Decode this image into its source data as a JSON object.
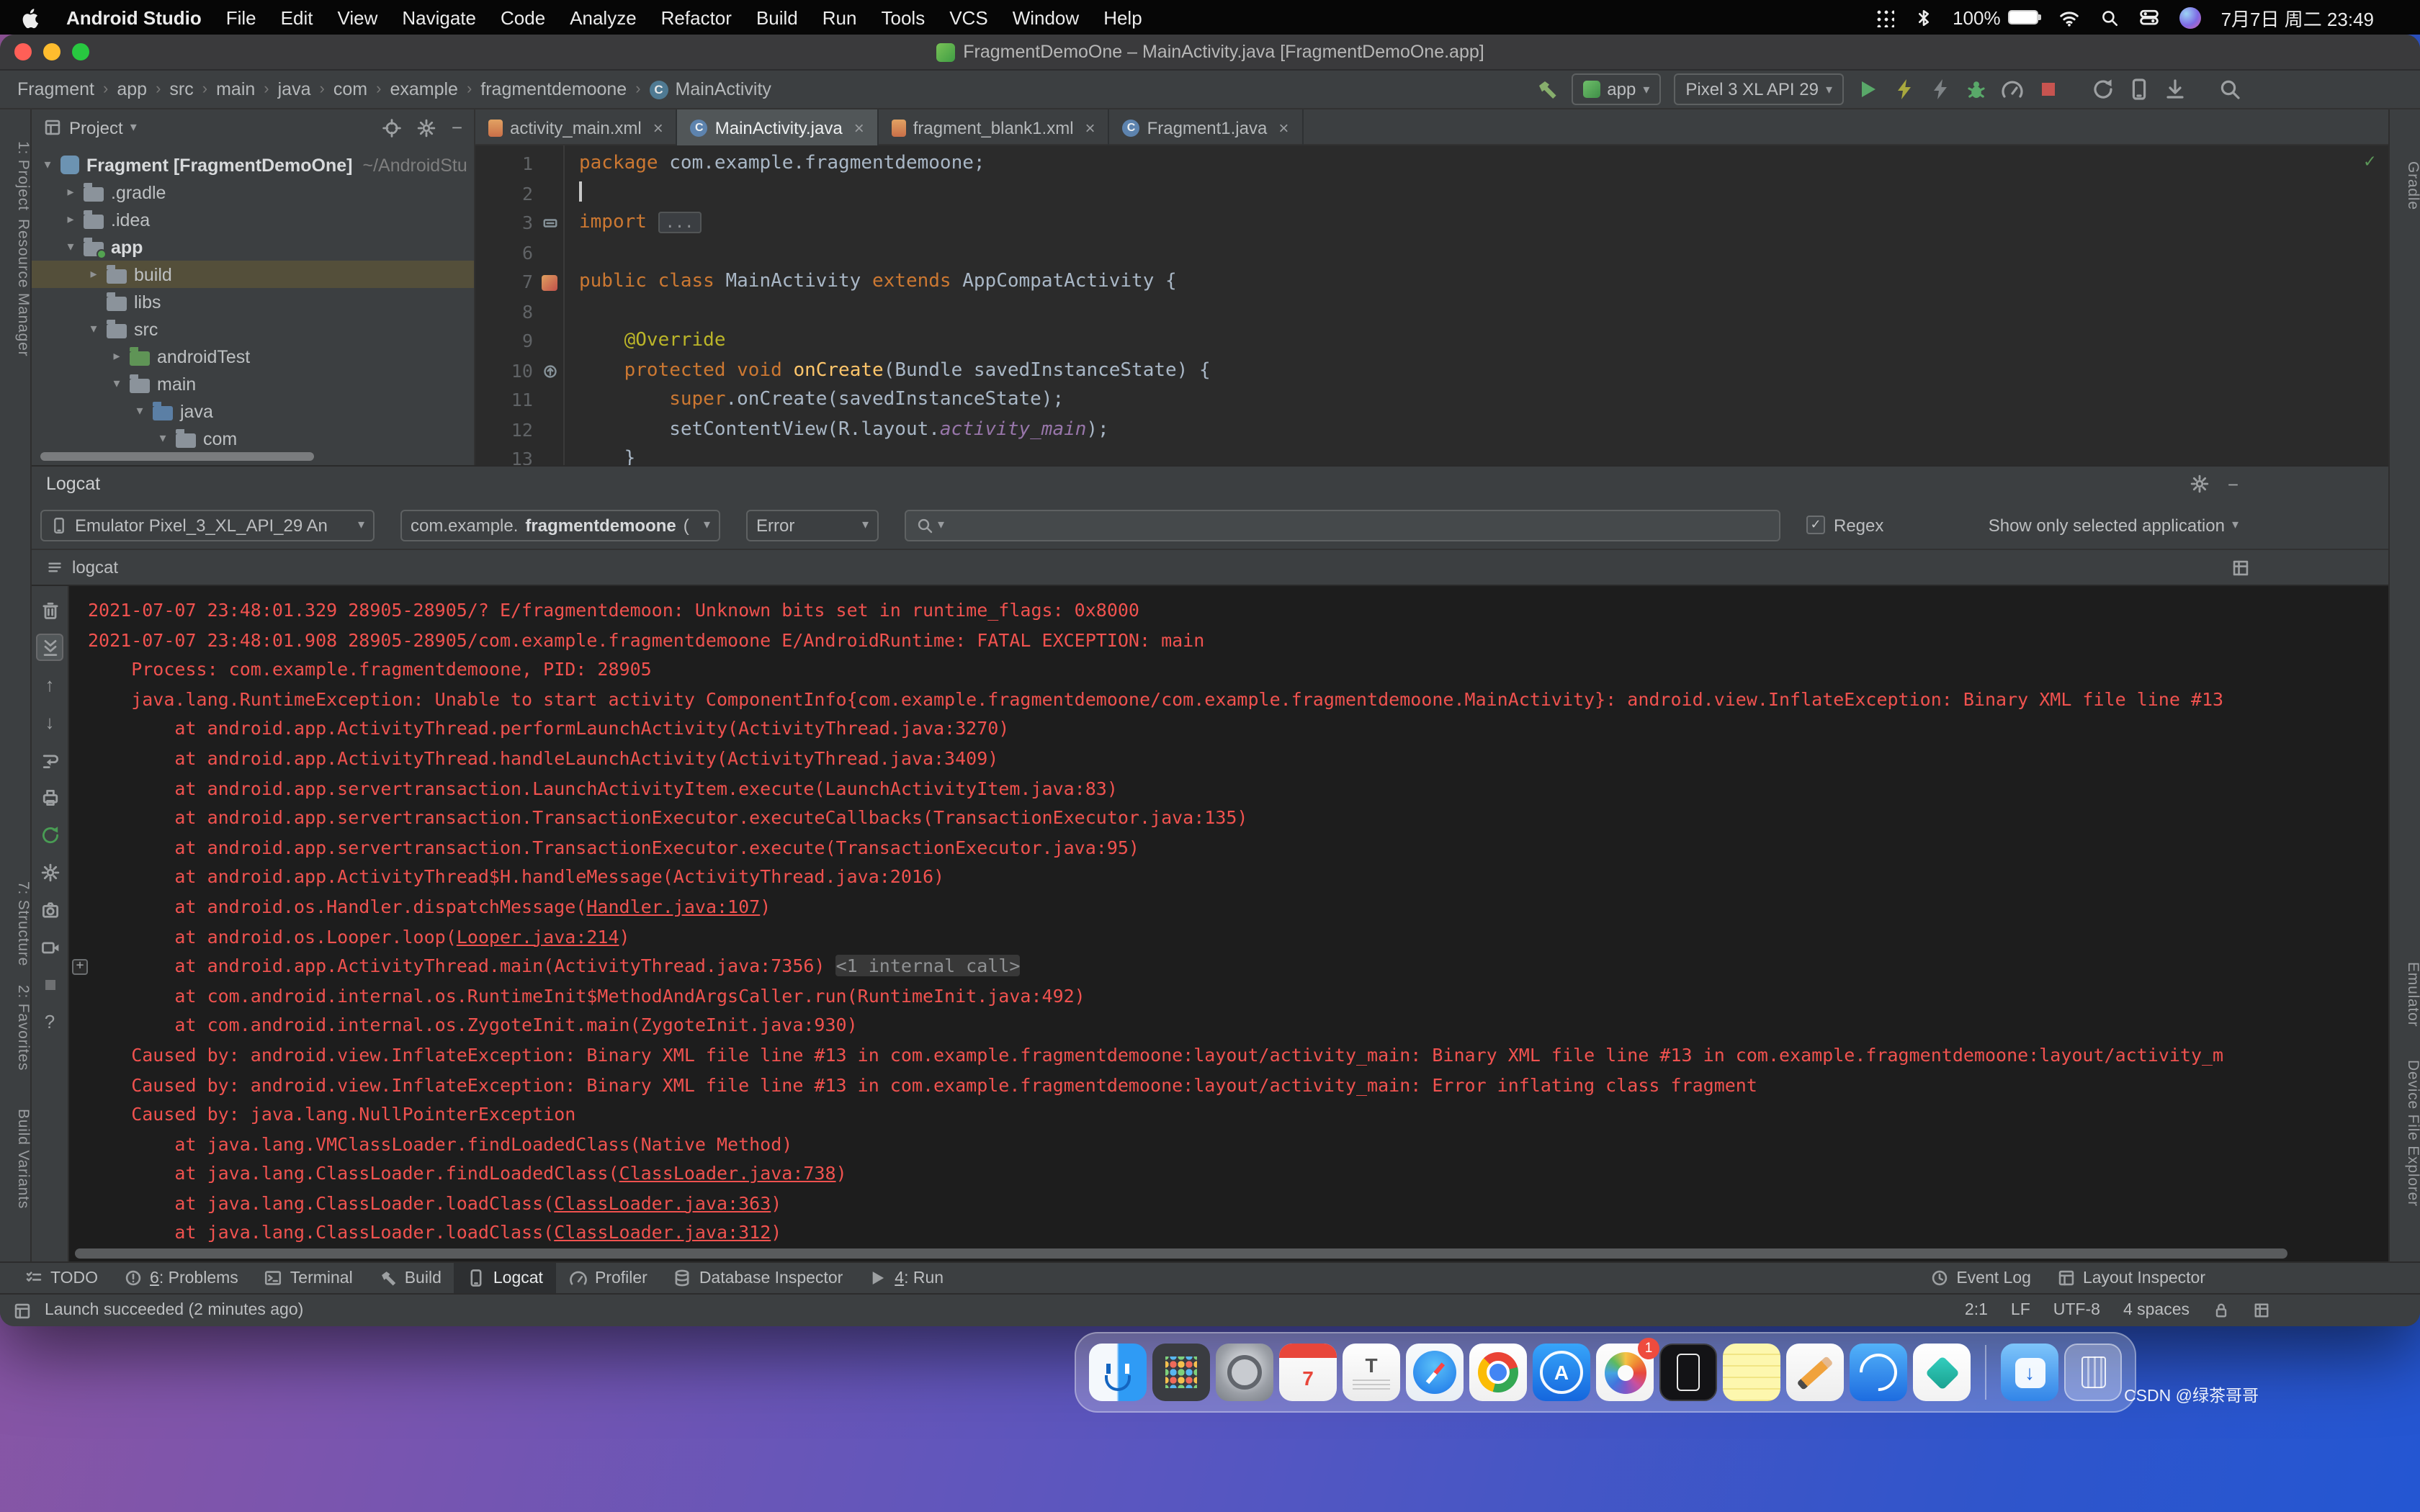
{
  "menu_bar": {
    "app_name": "Android Studio",
    "menus": [
      "File",
      "Edit",
      "View",
      "Navigate",
      "Code",
      "Analyze",
      "Refactor",
      "Build",
      "Run",
      "Tools",
      "VCS",
      "Window",
      "Help"
    ],
    "battery": "100%",
    "clock": "7月7日 周二 23:49"
  },
  "window_title": "FragmentDemoOne – MainActivity.java [FragmentDemoOne.app]",
  "breadcrumbs": {
    "items": [
      "Fragment",
      "app",
      "src",
      "main",
      "java",
      "com",
      "example",
      "fragmentdemoone"
    ],
    "leaf": "MainActivity"
  },
  "run_toolbar": {
    "config": "app",
    "device": "Pixel 3 XL API 29",
    "actions": [
      {
        "name": "run-icon",
        "icon": "play",
        "color": "#59a869"
      },
      {
        "name": "apply-changes-icon",
        "icon": "bolt",
        "color": "#a9a93e"
      },
      {
        "name": "apply-code-changes-icon",
        "icon": "bolt",
        "color": "#7f8487"
      },
      {
        "name": "debug-icon",
        "icon": "bug",
        "color": "#59a869"
      },
      {
        "name": "profiler-icon",
        "icon": "gauge",
        "color": "#9da0a2"
      },
      {
        "name": "stop-icon",
        "icon": "stop",
        "color": "#c75450"
      },
      {
        "name": "sync-gradle-icon",
        "icon": "sync",
        "color": "#9da0a2",
        "gap": true
      },
      {
        "name": "avd-manager-icon",
        "icon": "phone",
        "color": "#9da0a2"
      },
      {
        "name": "sdk-manager-icon",
        "icon": "download",
        "color": "#9da0a2"
      },
      {
        "name": "search-everywhere-icon",
        "icon": "search",
        "color": "#9da0a2",
        "gap": true
      }
    ]
  },
  "project_panel": {
    "title": "Project",
    "tree": [
      {
        "label": "Fragment [FragmentDemoOne]",
        "hint": "~/AndroidStu",
        "indent": 0,
        "chev": "▾",
        "icon": "project",
        "bold": true
      },
      {
        "label": ".gradle",
        "indent": 1,
        "chev": "▸",
        "icon": "folder"
      },
      {
        "label": ".idea",
        "indent": 1,
        "chev": "▸",
        "icon": "folder"
      },
      {
        "label": "app",
        "indent": 1,
        "chev": "▾",
        "icon": "module",
        "bold": true
      },
      {
        "label": "build",
        "indent": 2,
        "chev": "▸",
        "icon": "folder",
        "selected": true
      },
      {
        "label": "libs",
        "indent": 2,
        "chev": "",
        "icon": "folder"
      },
      {
        "label": "src",
        "indent": 2,
        "chev": "▾",
        "icon": "folder"
      },
      {
        "label": "androidTest",
        "indent": 3,
        "chev": "▸",
        "icon": "folder-green"
      },
      {
        "label": "main",
        "indent": 3,
        "chev": "▾",
        "icon": "folder"
      },
      {
        "label": "java",
        "indent": 4,
        "chev": "▾",
        "icon": "folder-blue"
      },
      {
        "label": "com",
        "indent": 5,
        "chev": "▾",
        "icon": "folder"
      }
    ]
  },
  "editor": {
    "tabs": [
      {
        "label": "activity_main.xml",
        "icon": "xml",
        "active": false
      },
      {
        "label": "MainActivity.java",
        "icon": "class",
        "active": true
      },
      {
        "label": "fragment_blank1.xml",
        "icon": "xml",
        "active": false
      },
      {
        "label": "Fragment1.java",
        "icon": "class",
        "active": false
      }
    ],
    "code": [
      {
        "n": "1",
        "seg": [
          [
            "kw",
            "package "
          ],
          [
            "pl",
            "com.example.fragmentdemoone;"
          ]
        ]
      },
      {
        "n": "2",
        "caret": true,
        "seg": []
      },
      {
        "n": "3",
        "gicon": "fold",
        "seg": [
          [
            "kw",
            "import "
          ],
          [
            "fold",
            "..."
          ]
        ]
      },
      {
        "n": "6",
        "seg": []
      },
      {
        "n": "7",
        "gicon": "class",
        "seg": [
          [
            "kw",
            "public class "
          ],
          [
            "pl",
            "MainActivity "
          ],
          [
            "kw",
            "extends "
          ],
          [
            "pl",
            "AppCompatActivity {"
          ]
        ]
      },
      {
        "n": "8",
        "seg": []
      },
      {
        "n": "9",
        "seg": [
          [
            "an",
            "    @Override"
          ]
        ]
      },
      {
        "n": "10",
        "gicon": "override",
        "seg": [
          [
            "kw",
            "    protected void "
          ],
          [
            "mth",
            "onCreate"
          ],
          [
            "pl",
            "(Bundle savedInstanceState) {"
          ]
        ]
      },
      {
        "n": "11",
        "seg": [
          [
            "kw",
            "        super"
          ],
          [
            "pl",
            ".onCreate(savedInstanceState);"
          ]
        ]
      },
      {
        "n": "12",
        "seg": [
          [
            "pl",
            "        setContentView(R.layout."
          ],
          [
            "res",
            "activity_main"
          ],
          [
            "pl",
            ");"
          ]
        ]
      },
      {
        "n": "13",
        "seg": [
          [
            "pl",
            "    }"
          ]
        ]
      }
    ]
  },
  "logcat": {
    "title": "Logcat",
    "device_filter": "Emulator Pixel_3_XL_API_29 An",
    "app_prefix": "com.example.",
    "app_bold": "fragmentdemoone",
    "app_suffix": " (",
    "level": "Error",
    "regex_label": "Regex",
    "scope": "Show only selected application",
    "tab": "logcat",
    "lines": [
      {
        "seg": [
          [
            "t",
            "2021-07-07 23:48:01.329 28905-28905/? E/fragmentdemoon: Unknown bits set in runtime_flags: 0x8000"
          ]
        ]
      },
      {
        "seg": [
          [
            "t",
            "2021-07-07 23:48:01.908 28905-28905/com.example.fragmentdemoone E/AndroidRuntime: FATAL EXCEPTION: main"
          ]
        ]
      },
      {
        "seg": [
          [
            "t",
            "    Process: com.example.fragmentdemoone, PID: 28905"
          ]
        ]
      },
      {
        "seg": [
          [
            "t",
            "    java.lang.RuntimeException: Unable to start activity ComponentInfo{com.example.fragmentdemoone/com.example.fragmentdemoone.MainActivity}: android.view.InflateException: Binary XML file line #13"
          ]
        ]
      },
      {
        "seg": [
          [
            "t",
            "        at android.app.ActivityThread.performLaunchActivity(ActivityThread.java:3270)"
          ]
        ]
      },
      {
        "seg": [
          [
            "t",
            "        at android.app.ActivityThread.handleLaunchActivity(ActivityThread.java:3409)"
          ]
        ]
      },
      {
        "seg": [
          [
            "t",
            "        at android.app.servertransaction.LaunchActivityItem.execute(LaunchActivityItem.java:83)"
          ]
        ]
      },
      {
        "seg": [
          [
            "t",
            "        at android.app.servertransaction.TransactionExecutor.executeCallbacks(TransactionExecutor.java:135)"
          ]
        ]
      },
      {
        "seg": [
          [
            "t",
            "        at android.app.servertransaction.TransactionExecutor.execute(TransactionExecutor.java:95)"
          ]
        ]
      },
      {
        "seg": [
          [
            "t",
            "        at android.app.ActivityThread$H.handleMessage(ActivityThread.java:2016)"
          ]
        ]
      },
      {
        "seg": [
          [
            "t",
            "        at android.os.Handler.dispatchMessage("
          ],
          [
            "l",
            "Handler.java:107"
          ],
          [
            "t",
            ")"
          ]
        ]
      },
      {
        "seg": [
          [
            "t",
            "        at android.os.Looper.loop("
          ],
          [
            "l",
            "Looper.java:214"
          ],
          [
            "t",
            ")"
          ]
        ]
      },
      {
        "exp": true,
        "seg": [
          [
            "t",
            "        at android.app.ActivityThread.main(ActivityThread.java:7356) "
          ],
          [
            "m",
            "<1 internal call>"
          ]
        ]
      },
      {
        "seg": [
          [
            "t",
            "        at com.android.internal.os.RuntimeInit$MethodAndArgsCaller.run(RuntimeInit.java:492)"
          ]
        ]
      },
      {
        "seg": [
          [
            "t",
            "        at com.android.internal.os.ZygoteInit.main(ZygoteInit.java:930)"
          ]
        ]
      },
      {
        "seg": [
          [
            "t",
            "    Caused by: android.view.InflateException: Binary XML file line #13 in com.example.fragmentdemoone:layout/activity_main: Binary XML file line #13 in com.example.fragmentdemoone:layout/activity_m"
          ]
        ]
      },
      {
        "seg": [
          [
            "t",
            "    Caused by: android.view.InflateException: Binary XML file line #13 in com.example.fragmentdemoone:layout/activity_main: Error inflating class fragment"
          ]
        ]
      },
      {
        "seg": [
          [
            "t",
            "    Caused by: java.lang.NullPointerException"
          ]
        ]
      },
      {
        "seg": [
          [
            "t",
            "        at java.lang.VMClassLoader.findLoadedClass(Native Method)"
          ]
        ]
      },
      {
        "seg": [
          [
            "t",
            "        at java.lang.ClassLoader.findLoadedClass("
          ],
          [
            "l",
            "ClassLoader.java:738"
          ],
          [
            "t",
            ")"
          ]
        ]
      },
      {
        "seg": [
          [
            "t",
            "        at java.lang.ClassLoader.loadClass("
          ],
          [
            "l",
            "ClassLoader.java:363"
          ],
          [
            "t",
            ")"
          ]
        ]
      },
      {
        "seg": [
          [
            "t",
            "        at java.lang.ClassLoader.loadClass("
          ],
          [
            "l",
            "ClassLoader.java:312"
          ],
          [
            "t",
            ")"
          ]
        ]
      }
    ]
  },
  "logcat_rail": [
    {
      "name": "clear-logcat-icon",
      "icon": "trash"
    },
    {
      "name": "scroll-to-end-icon",
      "icon": "scrollend",
      "active": true
    },
    {
      "name": "up-stack-trace-icon",
      "glyph": "↑"
    },
    {
      "name": "down-stack-trace-icon",
      "glyph": "↓"
    },
    {
      "name": "soft-wrap-icon",
      "icon": "wrap"
    },
    {
      "name": "print-icon",
      "icon": "print"
    },
    {
      "name": "restart-logcat-icon",
      "icon": "sync",
      "color": "#499c54"
    },
    {
      "name": "logcat-header-settings-icon",
      "icon": "gear"
    },
    {
      "name": "screenshot-icon",
      "icon": "camera"
    },
    {
      "name": "screen-record-icon",
      "icon": "video"
    },
    {
      "name": "pane-icon",
      "icon": "square",
      "color": "#6e7072"
    },
    {
      "name": "help-icon",
      "glyph": "?"
    }
  ],
  "bottom_bar": {
    "left": [
      {
        "label": "TODO",
        "icon": "todo"
      },
      {
        "mnemonic": "6",
        "label": ": Problems",
        "icon": "problems"
      },
      {
        "label": "Terminal",
        "icon": "terminal"
      },
      {
        "label": "Build",
        "icon": "hammer"
      },
      {
        "label": "Logcat",
        "icon": "phone",
        "active": true
      },
      {
        "label": "Profiler",
        "icon": "gauge"
      },
      {
        "label": "Database Inspector",
        "icon": "db"
      },
      {
        "mnemonic": "4",
        "label": ": Run",
        "icon": "play"
      }
    ],
    "right": [
      {
        "label": "Event Log",
        "icon": "clock"
      },
      {
        "label": "Layout Inspector",
        "icon": "layout"
      }
    ]
  },
  "status_bar": {
    "message": "Launch succeeded (2 minutes ago)",
    "caret": "2:1",
    "line_ending": "LF",
    "encoding": "UTF-8",
    "indent": "4 spaces"
  },
  "left_stripe": [
    {
      "label": "1: Project"
    },
    {
      "label": "Resource Manager"
    },
    {
      "label": "7: Structure"
    },
    {
      "label": "2: Favorites"
    },
    {
      "label": "Build Variants"
    }
  ],
  "right_stripe": [
    {
      "label": "Gradle"
    },
    {
      "label": "Emulator"
    },
    {
      "label": "Device File Explorer"
    }
  ],
  "dock": [
    {
      "name": "finder",
      "style": "finder"
    },
    {
      "name": "launchpad",
      "style": "launchpad"
    },
    {
      "name": "system-preferences",
      "style": "prefs"
    },
    {
      "name": "calendar",
      "style": "calendar",
      "glyph": "7"
    },
    {
      "name": "textedit",
      "style": "textedit",
      "glyph": "T"
    },
    {
      "name": "safari",
      "style": "safari"
    },
    {
      "name": "chrome",
      "style": "chrome"
    },
    {
      "name": "app-store",
      "style": "appstore",
      "glyph": "A"
    },
    {
      "name": "photos",
      "style": "photos",
      "badge": "1"
    },
    {
      "name": "mobile-app",
      "style": "black"
    },
    {
      "name": "stickies",
      "style": "stickies"
    },
    {
      "name": "pencil-app",
      "style": "pencil"
    },
    {
      "name": "blue-app",
      "style": "blueapp"
    },
    {
      "name": "diamond-app",
      "style": "diamond"
    },
    {
      "name": "separator",
      "style": "sep"
    },
    {
      "name": "downloads",
      "style": "downloads",
      "glyph": "↓"
    },
    {
      "name": "trash",
      "style": "trash"
    }
  ],
  "watermark": "CSDN @绿茶哥哥"
}
